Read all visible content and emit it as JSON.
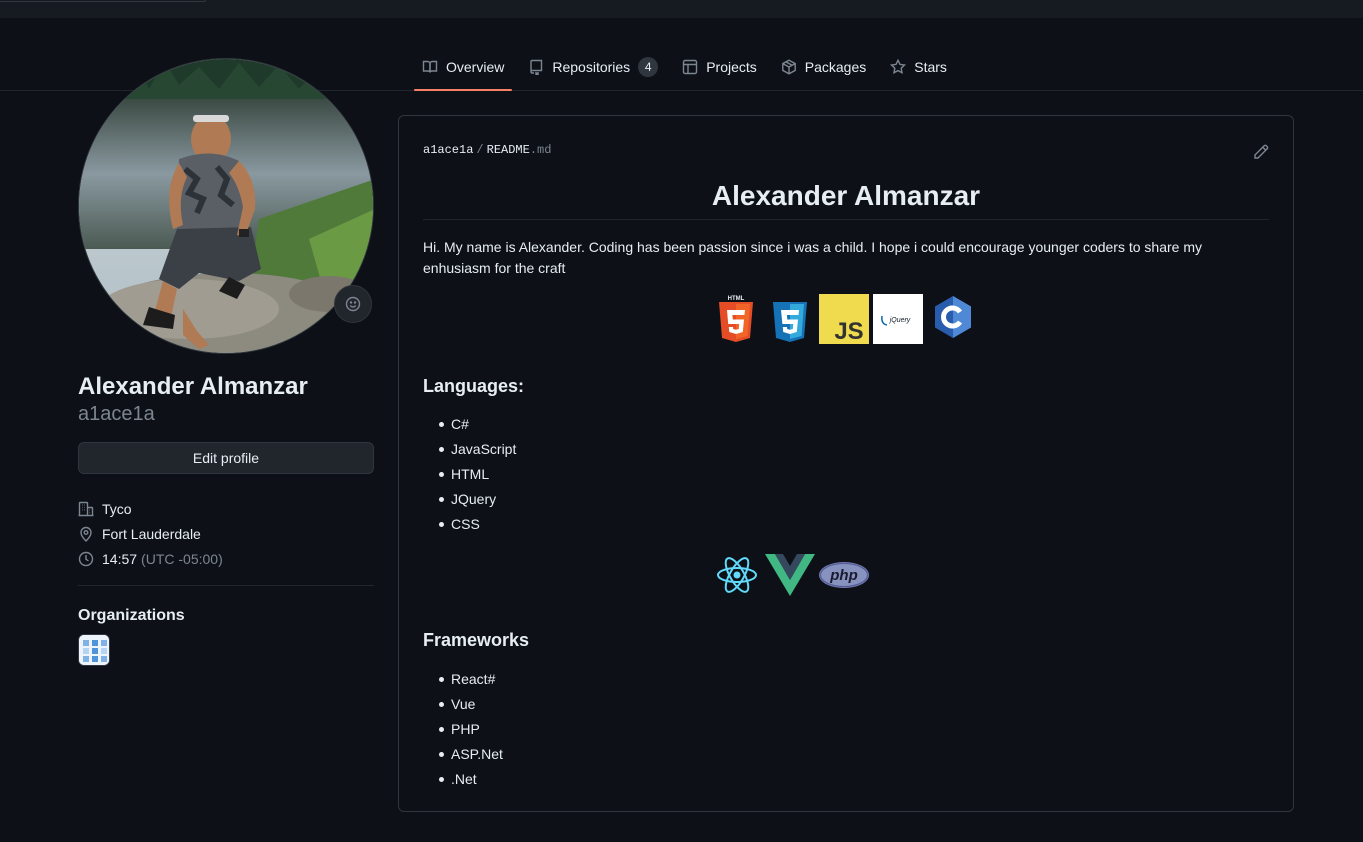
{
  "tabs": [
    {
      "label": "Overview",
      "icon": "book-icon",
      "active": true
    },
    {
      "label": "Repositories",
      "icon": "repo-icon",
      "count": "4"
    },
    {
      "label": "Projects",
      "icon": "table-icon"
    },
    {
      "label": "Packages",
      "icon": "package-icon"
    },
    {
      "label": "Stars",
      "icon": "star-icon"
    }
  ],
  "profile": {
    "name": "Alexander Almanzar",
    "login": "a1ace1a",
    "edit_label": "Edit profile",
    "company": "Tyco",
    "location": "Fort Lauderdale",
    "time": "14:57",
    "timezone": "(UTC -05:00)",
    "organizations_heading": "Organizations"
  },
  "readme": {
    "owner": "a1ace1a",
    "separator": "/",
    "file": "README",
    "ext": ".md",
    "title": "Alexander Almanzar",
    "intro": "Hi. My name is Alexander. Coding has been passion since i was a child. I hope i could encourage younger coders to share my enhusiasm for the craft",
    "badges": [
      "html5-icon",
      "css3-icon",
      "javascript-icon",
      "jquery-icon",
      "csharp-icon"
    ],
    "badge_text": {
      "html": "HTML",
      "js": "JS",
      "jquery": "jQuery",
      "php": "php"
    },
    "languages_heading": "Languages:",
    "languages": [
      "C#",
      "JavaScript",
      "HTML",
      "JQuery",
      "CSS"
    ],
    "framework_icons": [
      "react-icon",
      "vue-icon",
      "php-icon"
    ],
    "frameworks_heading": "Frameworks",
    "frameworks": [
      "React#",
      "Vue",
      "PHP",
      "ASP.Net",
      ".Net"
    ]
  },
  "colors": {
    "background": "#0d1117",
    "border": "#30363d",
    "text": "#e6edf3",
    "muted": "#7d8590",
    "active_tab_underline": "#f78166"
  }
}
